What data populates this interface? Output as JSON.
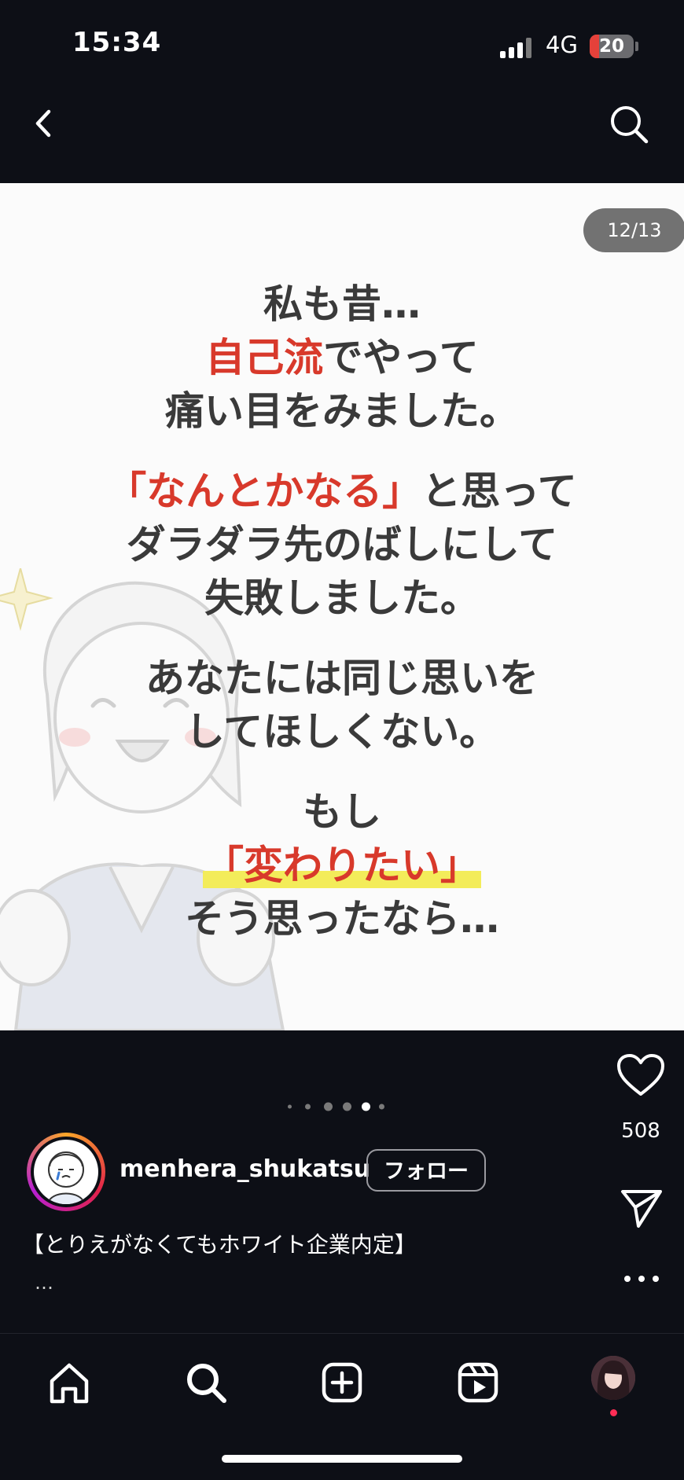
{
  "status_bar": {
    "time": "15:34",
    "network": "4G",
    "battery": "20"
  },
  "post": {
    "counter": "12/13",
    "text_blocks": [
      [
        [
          {
            "t": "私も昔…",
            "s": "normal"
          }
        ],
        [
          {
            "t": "自己流",
            "s": "red"
          },
          {
            "t": "でやって",
            "s": "normal"
          }
        ],
        [
          {
            "t": "痛い目をみました。",
            "s": "normal"
          }
        ]
      ],
      [
        [
          {
            "t": "「なんとかなる」",
            "s": "red"
          },
          {
            "t": "と思って",
            "s": "normal"
          }
        ],
        [
          {
            "t": "ダラダラ先のばしにして",
            "s": "normal"
          }
        ],
        [
          {
            "t": "失敗しました。",
            "s": "normal"
          }
        ]
      ],
      [
        [
          {
            "t": "あなたには同じ思いを",
            "s": "normal"
          }
        ],
        [
          {
            "t": "してほしくない。",
            "s": "normal"
          }
        ]
      ],
      [
        [
          {
            "t": "もし",
            "s": "normal"
          }
        ],
        [
          {
            "t": "「変わりたい」",
            "s": "red-marker"
          }
        ],
        [
          {
            "t": "そう思ったなら…",
            "s": "normal"
          }
        ]
      ]
    ],
    "carousel": {
      "active_index": 4,
      "dot_count": 6
    },
    "likes": "508",
    "username": "menhera_shukatsu",
    "follow_label": "フォロー",
    "caption": "【とりえがなくてもホワイト企業内定】",
    "caption_more": "…"
  },
  "colors": {
    "accent_red": "#d8392b",
    "highlight": "#f3ec5a",
    "background": "#0d0f16"
  },
  "icons": {
    "nav": [
      "back-chevron-icon",
      "search-icon"
    ],
    "actions": [
      "heart-icon",
      "share-icon",
      "more-icon"
    ],
    "tabs": [
      "home-icon",
      "search-icon",
      "create-icon",
      "reels-icon",
      "profile-avatar"
    ]
  }
}
